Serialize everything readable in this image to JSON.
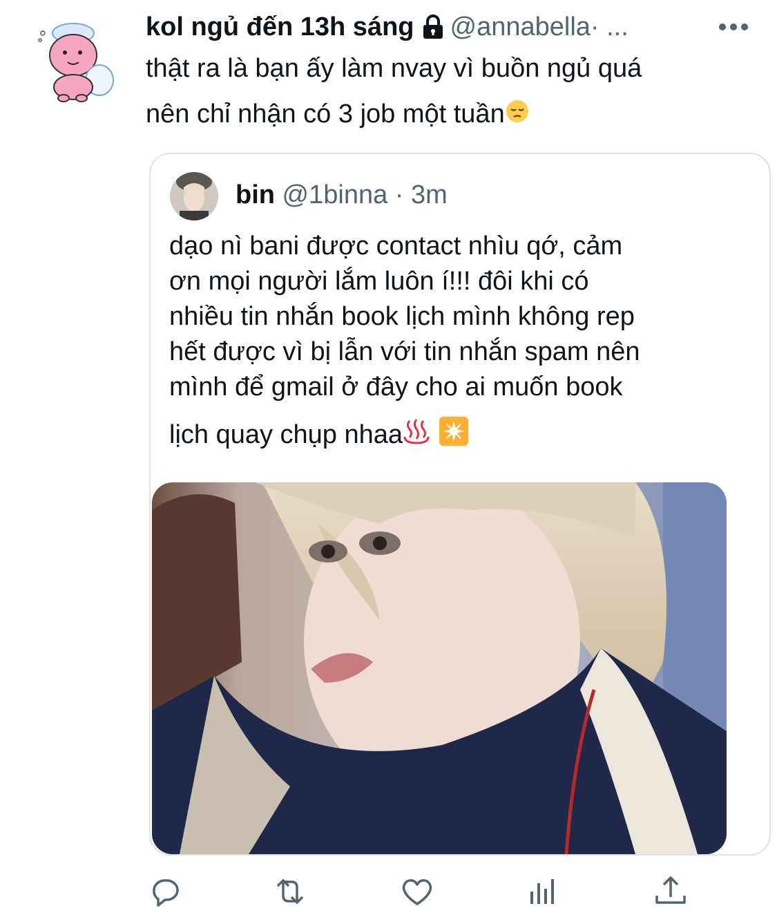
{
  "tweet": {
    "display_name": "kol ngủ đến 13h sáng",
    "handle": "@annabella",
    "meta_suffix": " · ...",
    "text_line1": "thật ra là bạn ấy làm nvay vì buồn ngủ quá",
    "text_line2": "nên chỉ nhận có 3 job một tuần"
  },
  "quote": {
    "display_name": "bin",
    "handle": "@1binna",
    "time": " · 3m",
    "lines": [
      "dạo nì bani được contact nhìu qớ, cảm",
      "ơn mọi người lắm luôn í!!! đôi khi có",
      "nhiều tin nhắn book lịch mình không rep",
      "hết được vì bị lẫn với tin nhắn spam nên",
      "mình để gmail ở đây cho ai muốn book",
      "lịch quay chụp nhaa"
    ]
  },
  "icons": {
    "lock": "lock-icon",
    "more": "more-icon",
    "reply": "reply-icon",
    "retweet": "retweet-icon",
    "like": "heart-icon",
    "analytics": "analytics-icon",
    "share": "share-icon"
  },
  "colors": {
    "text": "#0f1419",
    "secondary": "#536471",
    "icon": "#536471",
    "border": "#dde3e8"
  }
}
